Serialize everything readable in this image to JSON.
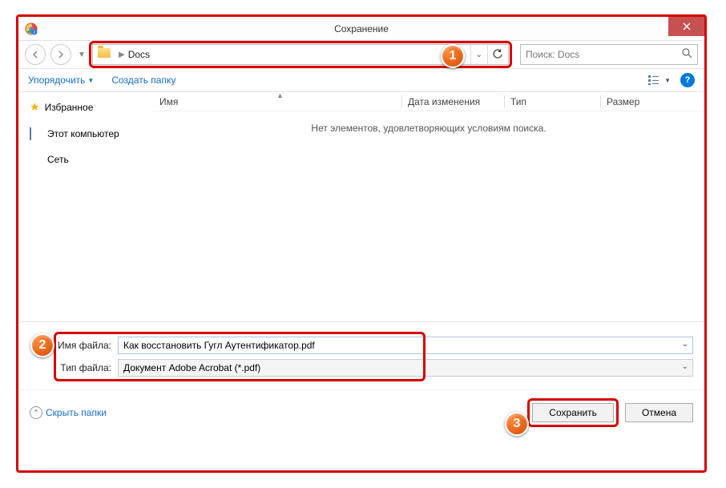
{
  "titlebar": {
    "title": "Сохранение"
  },
  "nav": {
    "address_folder": "Docs",
    "search_placeholder": "Поиск: Docs"
  },
  "toolbar": {
    "organize": "Упорядочить",
    "new_folder": "Создать папку"
  },
  "sidebar": {
    "favorites": "Избранное",
    "this_pc": "Этот компьютер",
    "network": "Сеть"
  },
  "columns": {
    "name": "Имя",
    "date": "Дата изменения",
    "type": "Тип",
    "size": "Размер"
  },
  "content": {
    "empty": "Нет элементов, удовлетворяющих условиям поиска."
  },
  "fields": {
    "filename_label": "Имя файла:",
    "filename_value": "Как восстановить Гугл Аутентификатор.pdf",
    "filetype_label": "Тип файла:",
    "filetype_value": "Документ Adobe Acrobat (*.pdf)"
  },
  "actions": {
    "hide_folders": "Скрыть папки",
    "save": "Сохранить",
    "cancel": "Отмена"
  },
  "badges": {
    "b1": "1",
    "b2": "2",
    "b3": "3"
  }
}
